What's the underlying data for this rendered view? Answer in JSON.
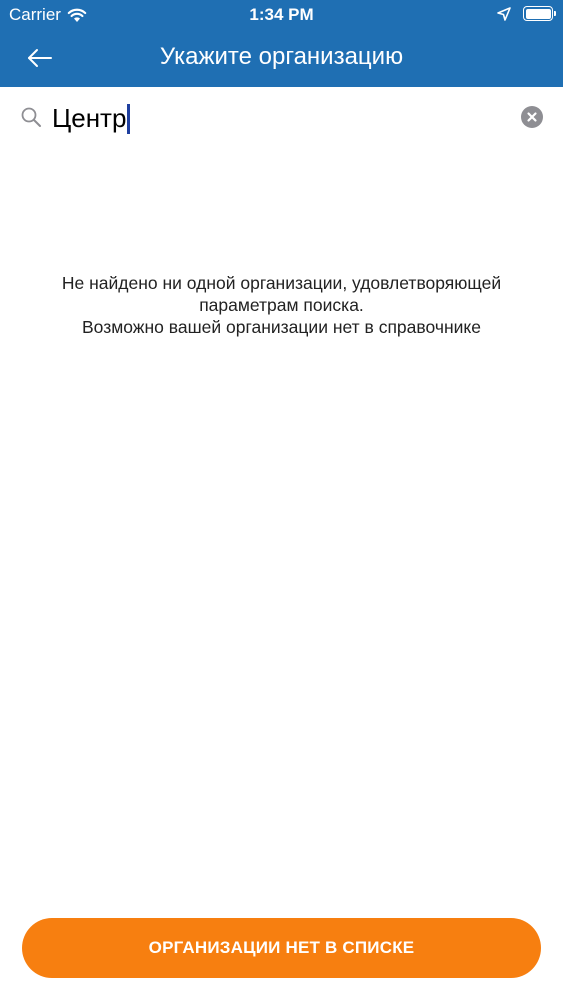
{
  "status_bar": {
    "carrier": "Carrier",
    "time": "1:34 PM"
  },
  "nav": {
    "title": "Укажите организацию"
  },
  "search": {
    "value": "Центр"
  },
  "empty_message": {
    "line1": "Не найдено ни одной организации, удовлетворяющей",
    "line2": "параметрам поиска.",
    "line3": "Возможно вашей организации нет в справочнике"
  },
  "footer": {
    "button_label": "ОРГАНИЗАЦИИ НЕТ В СПИСКЕ"
  },
  "colors": {
    "header": "#1f6fb3",
    "accent_button": "#f77f10"
  }
}
